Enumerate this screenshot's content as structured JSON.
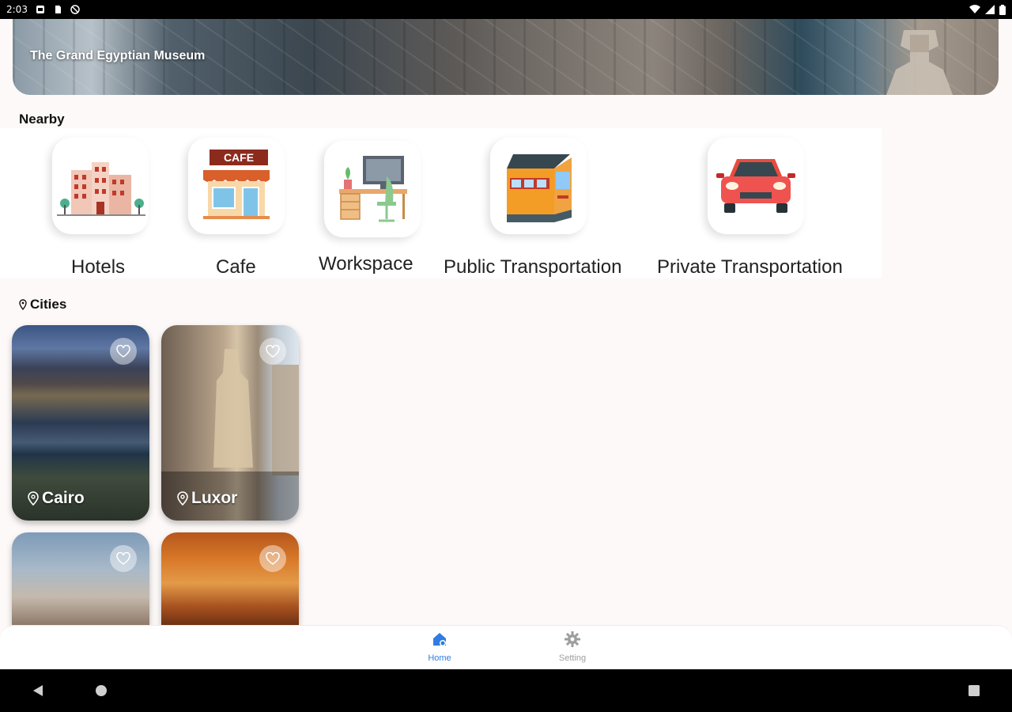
{
  "status_bar": {
    "time": "2:03"
  },
  "hero": {
    "title": "The Grand Egyptian Museum"
  },
  "nearby": {
    "title": "Nearby",
    "items": [
      {
        "label": "Hotels",
        "icon": "hotel-icon"
      },
      {
        "label": "Cafe",
        "icon": "cafe-icon",
        "sign": "CAFE"
      },
      {
        "label": "Workspace",
        "icon": "workspace-icon"
      },
      {
        "label": "Public Transportation",
        "icon": "train-icon"
      },
      {
        "label": "Private Transportation",
        "icon": "car-icon"
      }
    ]
  },
  "cities": {
    "title": "Cities",
    "items": [
      {
        "name": "Cairo"
      },
      {
        "name": "Luxor"
      },
      {
        "name": ""
      },
      {
        "name": ""
      }
    ]
  },
  "bottom_nav": {
    "items": [
      {
        "label": "Home",
        "active": true
      },
      {
        "label": "Setting",
        "active": false
      }
    ]
  },
  "colors": {
    "accent": "#2f7de1",
    "inactive": "#9e9e9e",
    "background": "#fdf9f8"
  }
}
